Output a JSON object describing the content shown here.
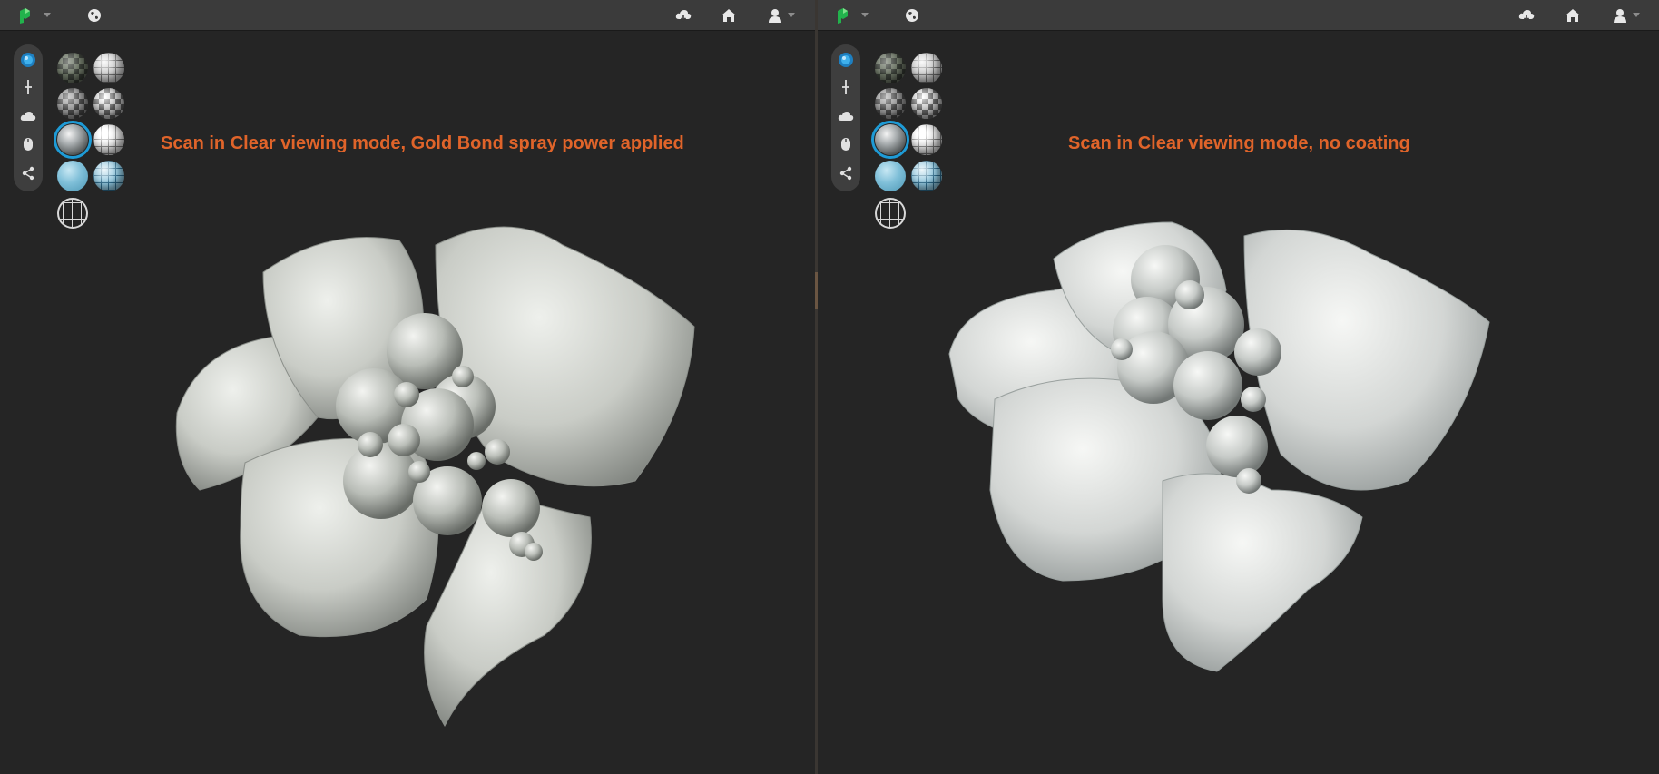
{
  "viewers": [
    {
      "caption": "Scan in Clear viewing mode, Gold Bond spray power applied"
    },
    {
      "caption": "Scan in Clear viewing mode, no coating"
    }
  ],
  "topbar": {
    "icons": [
      "app-logo-icon",
      "globe-icon",
      "cloud-download-icon",
      "home-icon",
      "user-icon"
    ]
  },
  "toolbar": {
    "icons": [
      "view-mode-icon",
      "pin-icon",
      "cloud-icon",
      "mouse-icon",
      "share-icon"
    ]
  },
  "material_palette": {
    "swatches": [
      "checker-dark",
      "grid-sphere",
      "checker-light",
      "checker-grid",
      "clear-smooth",
      "grid-light",
      "blue-smooth",
      "blue-grid",
      "wireframe"
    ],
    "selected": "clear-smooth"
  },
  "colors": {
    "background": "#252525",
    "caption": "#e0642a",
    "accent": "#1e9bd6",
    "model": "#d4d6d2"
  }
}
